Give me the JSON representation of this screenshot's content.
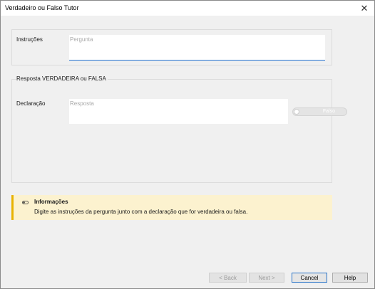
{
  "window": {
    "title": "Verdadeiro ou Falso Tutor",
    "close_glyph": "✕"
  },
  "instructions": {
    "label": "Instruções",
    "question_placeholder": "Pergunta",
    "question_value": ""
  },
  "answer_group": {
    "title": "Resposta VERDADEIRA ou FALSA",
    "declaration_label": "Declaração",
    "answer_placeholder": "Resposta",
    "answer_value": "",
    "toggle_label": "Falso",
    "toggle_on": false
  },
  "info": {
    "icon": "toggle-icon",
    "title": "Informações",
    "text": "Digite as instruções da pergunta junto com a declaração que for verdadeira ou falsa.",
    "accent_color": "#e8b200",
    "background_color": "#fcf2cf"
  },
  "buttons": {
    "back": "< Back",
    "next": "Next >",
    "cancel": "Cancel",
    "help": "Help"
  }
}
